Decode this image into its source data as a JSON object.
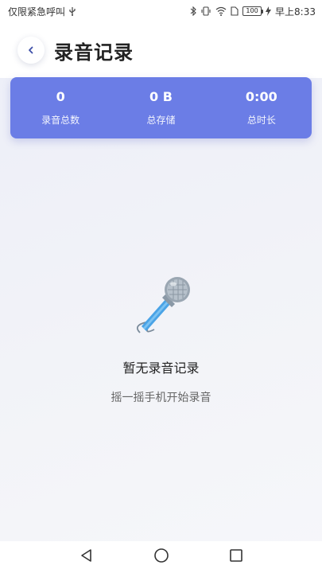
{
  "status_bar": {
    "left_text": "仅限紧急呼叫",
    "battery": "100",
    "time": "早上8:33"
  },
  "header": {
    "title": "录音记录"
  },
  "stats": [
    {
      "value": "0",
      "label": "录音总数"
    },
    {
      "value": "0 B",
      "label": "总存储"
    },
    {
      "value": "0:00",
      "label": "总时长"
    }
  ],
  "empty_state": {
    "title": "暂无录音记录",
    "subtitle": "摇一摇手机开始录音"
  },
  "colors": {
    "accent": "#6b7de6",
    "back_arrow": "#3d4fa8",
    "background": "#eef0f7"
  },
  "icons": {
    "back": "chevron-left-icon",
    "empty": "microphone-icon",
    "nav_back": "triangle-back-icon",
    "nav_home": "circle-home-icon",
    "nav_recents": "square-recents-icon"
  }
}
